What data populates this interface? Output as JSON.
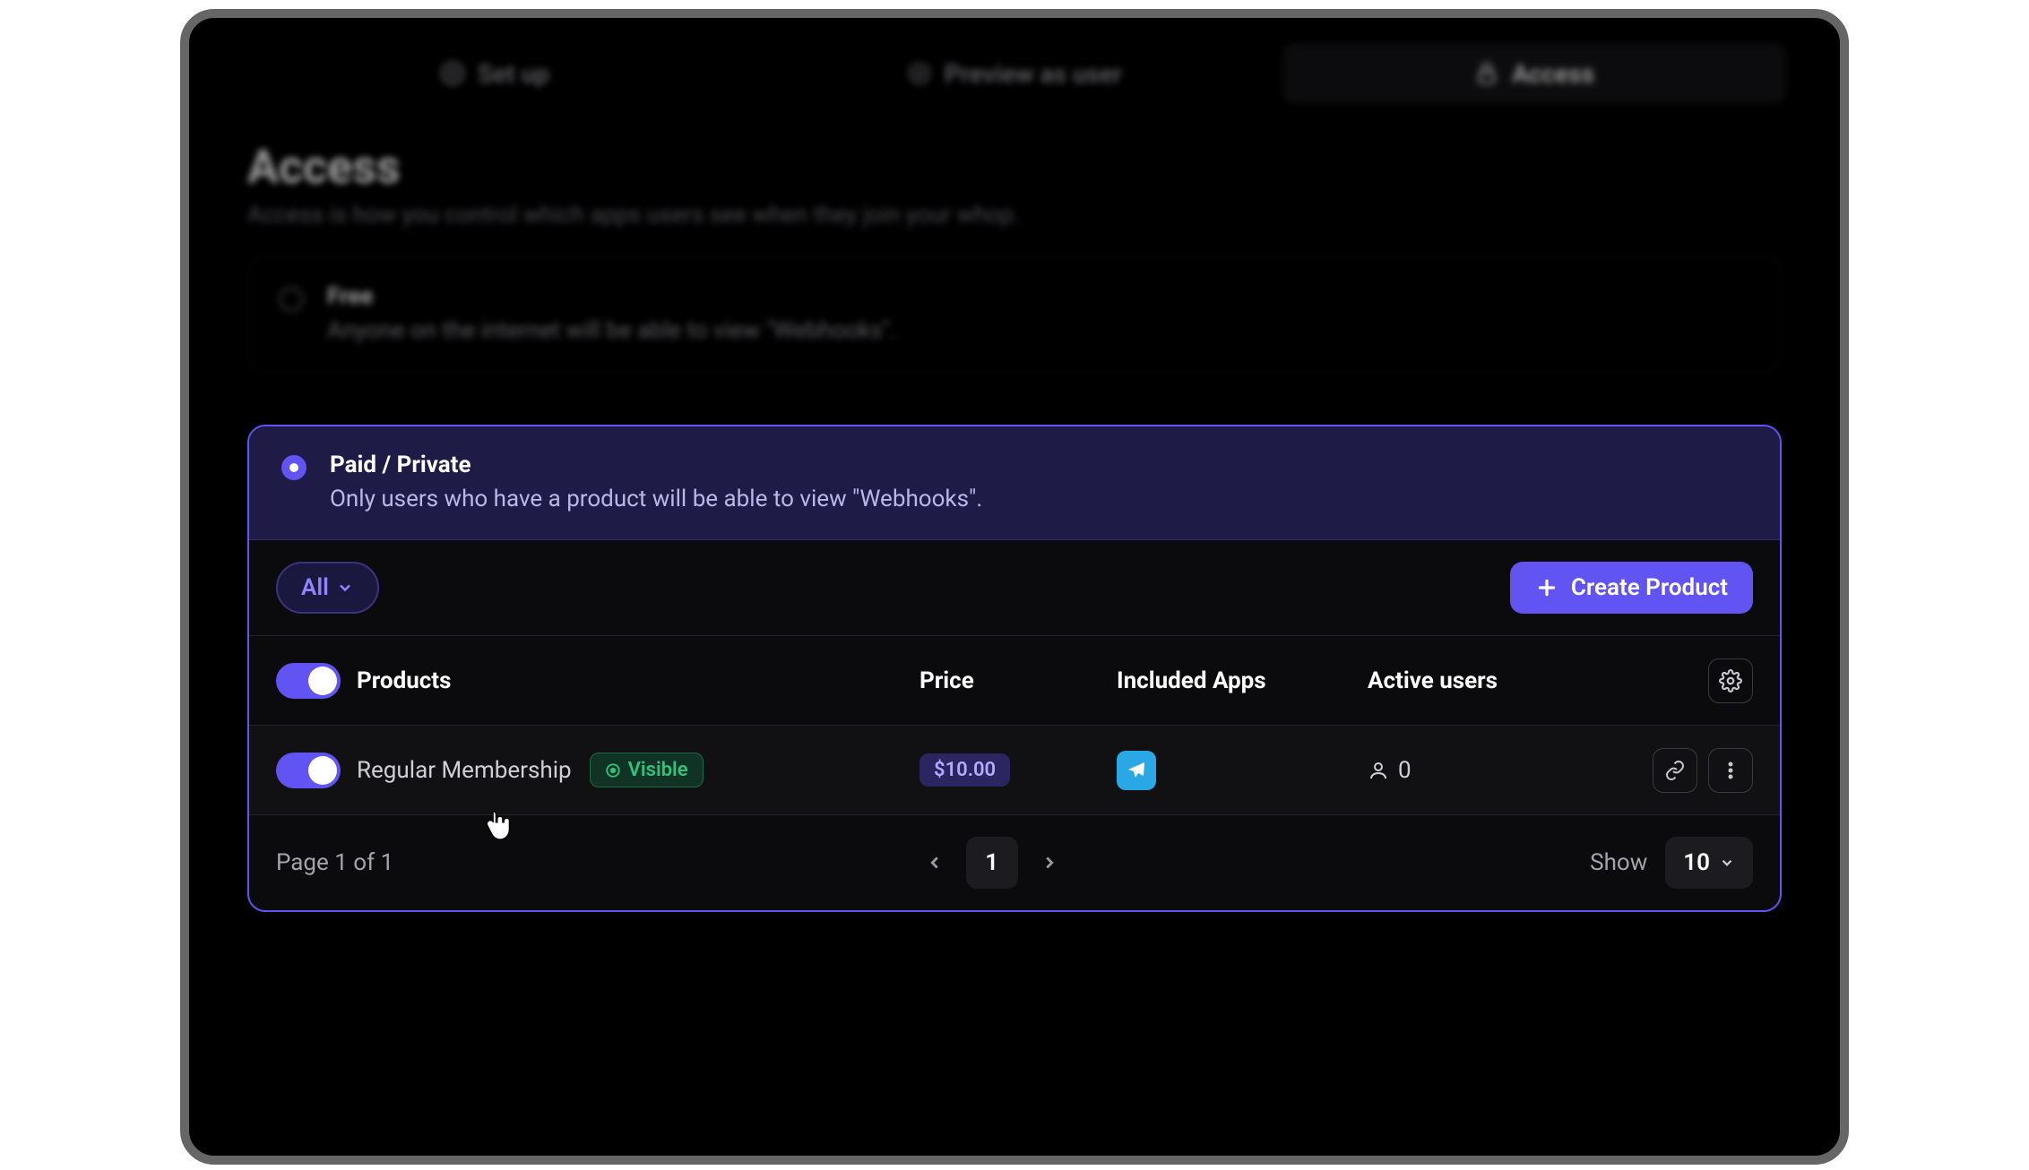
{
  "tabs": {
    "setup": "Set up",
    "preview": "Preview as user",
    "access": "Access"
  },
  "header": {
    "title": "Access",
    "subtitle": "Access is how you control which apps users see when they join your whop."
  },
  "free_card": {
    "title": "Free",
    "desc": "Anyone on the internet will be able to view \"Webhooks\"."
  },
  "paid_card": {
    "title": "Paid / Private",
    "desc": "Only users who have a product will be able to view \"Webhooks\"."
  },
  "toolbar": {
    "filter_label": "All",
    "create_label": "Create Product"
  },
  "columns": {
    "products": "Products",
    "price": "Price",
    "apps": "Included Apps",
    "users": "Active users"
  },
  "row": {
    "name": "Regular Membership",
    "visibility": "Visible",
    "price": "$10.00",
    "active_users": "0"
  },
  "pager": {
    "summary": "Page 1 of 1",
    "current": "1",
    "show_label": "Show",
    "show_value": "10"
  }
}
